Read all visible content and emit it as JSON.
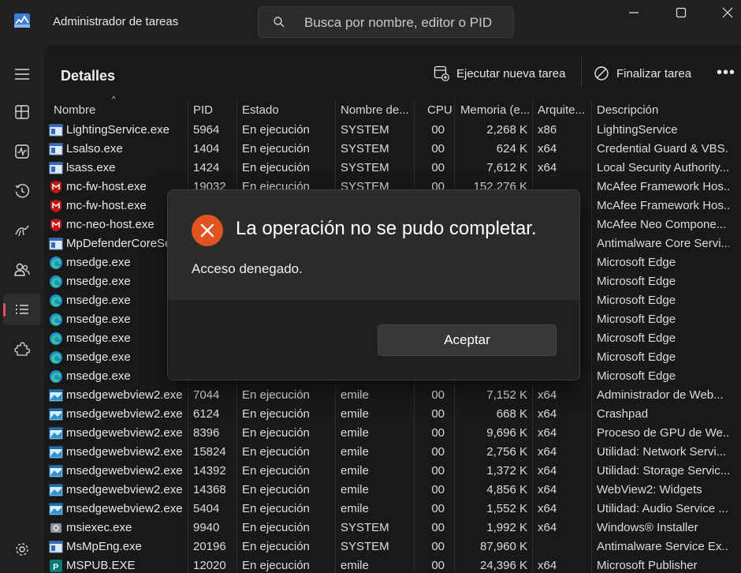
{
  "app": {
    "title": "Administrador de tareas",
    "accent": "#e65059"
  },
  "search": {
    "placeholder": "Busca por nombre, editor o PID"
  },
  "page": {
    "title": "Detalles"
  },
  "toolbar": {
    "run_new_task": "Ejecutar nueva tarea",
    "end_task": "Finalizar tarea",
    "more": "•••"
  },
  "columns": {
    "name": "Nombre",
    "pid": "PID",
    "status": "Estado",
    "user": "Nombre de...",
    "cpu": "CPU",
    "memory": "Memoria (e...",
    "arch": "Arquite...",
    "description": "Descripción"
  },
  "rows": [
    {
      "icon": "service-icon",
      "name": "LightingService.exe",
      "pid": "5964",
      "status": "En ejecución",
      "user": "SYSTEM",
      "cpu": "00",
      "memory": "2,268 K",
      "arch": "x86",
      "description": "LightingService"
    },
    {
      "icon": "service-icon",
      "name": "Lsalso.exe",
      "pid": "1404",
      "status": "En ejecución",
      "user": "SYSTEM",
      "cpu": "00",
      "memory": "624 K",
      "arch": "x64",
      "description": "Credential Guard & VBS..."
    },
    {
      "icon": "service-icon",
      "name": "lsass.exe",
      "pid": "1424",
      "status": "En ejecución",
      "user": "SYSTEM",
      "cpu": "00",
      "memory": "7,612 K",
      "arch": "x64",
      "description": "Local Security Authority..."
    },
    {
      "icon": "mcafee-icon",
      "name": "mc-fw-host.exe",
      "pid": "19032",
      "status": "En ejecución",
      "user": "SYSTEM",
      "cpu": "00",
      "memory": "152,276 K",
      "arch": "",
      "description": "McAfee Framework Hos..."
    },
    {
      "icon": "mcafee-icon",
      "name": "mc-fw-host.exe",
      "pid": "",
      "status": "",
      "user": "",
      "cpu": "",
      "memory": "",
      "arch": "",
      "description": "McAfee Framework Hos..."
    },
    {
      "icon": "mcafee-icon",
      "name": "mc-neo-host.exe",
      "pid": "",
      "status": "",
      "user": "",
      "cpu": "",
      "memory": "",
      "arch": "",
      "description": "McAfee Neo Compone..."
    },
    {
      "icon": "service-icon",
      "name": "MpDefenderCoreSe...",
      "pid": "",
      "status": "",
      "user": "",
      "cpu": "",
      "memory": "",
      "arch": "",
      "description": "Antimalware Core Servi..."
    },
    {
      "icon": "edge-icon",
      "name": "msedge.exe",
      "pid": "",
      "status": "",
      "user": "",
      "cpu": "",
      "memory": "",
      "arch": "",
      "description": "Microsoft Edge"
    },
    {
      "icon": "edge-icon",
      "name": "msedge.exe",
      "pid": "",
      "status": "",
      "user": "",
      "cpu": "",
      "memory": "",
      "arch": "",
      "description": "Microsoft Edge"
    },
    {
      "icon": "edge-icon",
      "name": "msedge.exe",
      "pid": "",
      "status": "",
      "user": "",
      "cpu": "",
      "memory": "",
      "arch": "",
      "description": "Microsoft Edge"
    },
    {
      "icon": "edge-icon",
      "name": "msedge.exe",
      "pid": "",
      "status": "",
      "user": "",
      "cpu": "",
      "memory": "",
      "arch": "",
      "description": "Microsoft Edge"
    },
    {
      "icon": "edge-icon",
      "name": "msedge.exe",
      "pid": "",
      "status": "",
      "user": "",
      "cpu": "",
      "memory": "",
      "arch": "",
      "description": "Microsoft Edge"
    },
    {
      "icon": "edge-icon",
      "name": "msedge.exe",
      "pid": "",
      "status": "",
      "user": "",
      "cpu": "",
      "memory": "",
      "arch": "",
      "description": "Microsoft Edge"
    },
    {
      "icon": "edge-icon",
      "name": "msedge.exe",
      "pid": "",
      "status": "",
      "user": "",
      "cpu": "",
      "memory": "",
      "arch": "",
      "description": "Microsoft Edge"
    },
    {
      "icon": "webview-icon",
      "name": "msedgewebview2.exe",
      "pid": "7044",
      "status": "En ejecución",
      "user": "emile",
      "cpu": "00",
      "memory": "7,152 K",
      "arch": "x64",
      "description": "Administrador de Web..."
    },
    {
      "icon": "webview-icon",
      "name": "msedgewebview2.exe",
      "pid": "6124",
      "status": "En ejecución",
      "user": "emile",
      "cpu": "00",
      "memory": "668 K",
      "arch": "x64",
      "description": "Crashpad"
    },
    {
      "icon": "webview-icon",
      "name": "msedgewebview2.exe",
      "pid": "8396",
      "status": "En ejecución",
      "user": "emile",
      "cpu": "00",
      "memory": "9,696 K",
      "arch": "x64",
      "description": "Proceso de GPU de We..."
    },
    {
      "icon": "webview-icon",
      "name": "msedgewebview2.exe",
      "pid": "15824",
      "status": "En ejecución",
      "user": "emile",
      "cpu": "00",
      "memory": "2,756 K",
      "arch": "x64",
      "description": "Utilidad: Network Servi..."
    },
    {
      "icon": "webview-icon",
      "name": "msedgewebview2.exe",
      "pid": "14392",
      "status": "En ejecución",
      "user": "emile",
      "cpu": "00",
      "memory": "1,372 K",
      "arch": "x64",
      "description": "Utilidad: Storage Servic..."
    },
    {
      "icon": "webview-icon",
      "name": "msedgewebview2.exe",
      "pid": "14368",
      "status": "En ejecución",
      "user": "emile",
      "cpu": "00",
      "memory": "4,856 K",
      "arch": "x64",
      "description": "WebView2: Widgets"
    },
    {
      "icon": "webview-icon",
      "name": "msedgewebview2.exe",
      "pid": "5404",
      "status": "En ejecución",
      "user": "emile",
      "cpu": "00",
      "memory": "1,552 K",
      "arch": "x64",
      "description": "Utilidad: Audio Service ..."
    },
    {
      "icon": "installer-icon",
      "name": "msiexec.exe",
      "pid": "9940",
      "status": "En ejecución",
      "user": "SYSTEM",
      "cpu": "00",
      "memory": "1,992 K",
      "arch": "x64",
      "description": "Windows® Installer"
    },
    {
      "icon": "service-icon",
      "name": "MsMpEng.exe",
      "pid": "20196",
      "status": "En ejecución",
      "user": "SYSTEM",
      "cpu": "00",
      "memory": "87,960 K",
      "arch": "",
      "description": "Antimalware Service Ex..."
    },
    {
      "icon": "publisher-icon",
      "name": "MSPUB.EXE",
      "pid": "12020",
      "status": "En ejecución",
      "user": "emile",
      "cpu": "00",
      "memory": "24,396 K",
      "arch": "x64",
      "description": "Microsoft Publisher"
    }
  ],
  "dialog": {
    "title": "La operación no se pudo completar.",
    "message": "Acceso denegado.",
    "accept": "Aceptar",
    "error_color": "#e2541f"
  }
}
